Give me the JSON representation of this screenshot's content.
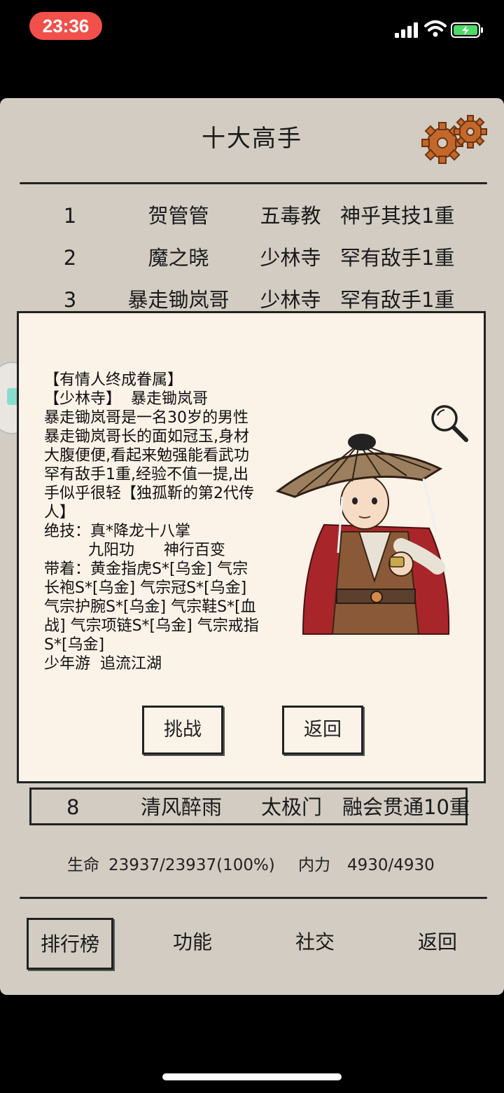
{
  "status_bar": {
    "time": "23:36",
    "time_pill_color": "#f2504a",
    "battery": "charging",
    "icons": [
      "signal-icon",
      "wifi-icon",
      "battery-icon"
    ]
  },
  "header": {
    "title": "十大高手",
    "settings_icon": "gear-icon"
  },
  "ranking": [
    {
      "rank": "1",
      "name": "贺管管",
      "sect": "五毒教",
      "level": "神乎其技1重"
    },
    {
      "rank": "2",
      "name": "魔之晓",
      "sect": "少林寺",
      "level": "罕有敌手1重"
    },
    {
      "rank": "3",
      "name": "暴走锄岚哥",
      "sect": "少林寺",
      "level": "罕有敌手1重"
    }
  ],
  "ranking_row8": {
    "rank": "8",
    "name": "清风醉雨",
    "sect": "太极门",
    "level": "融会贯通10重"
  },
  "detail": {
    "lines": [
      "【有情人终成眷属】",
      "【少林寺】  暴走锄岚哥",
      "暴走锄岚哥是一名30岁的男性",
      "暴走锄岚哥长的面如冠玉,身材大腹便便,看起来勉强能看武功罕有敌手1重,经验不值一提,出手似乎很轻【独孤靳的第2代传人】",
      "绝技：真*降龙十八掌",
      "         九阳功      神行百变",
      "带着：黄金指虎S*[乌金]  气宗长袍S*[乌金]  气宗冠S*[乌金]  气宗护腕S*[乌金]  气宗鞋S*[血战]  气宗项链S*[乌金]  气宗戒指S*[乌金]",
      "少年游  追流江湖"
    ],
    "challenge_label": "挑战",
    "back_label": "返回",
    "zoom_icon": "magnifier-icon"
  },
  "player": {
    "hp_label": "生命",
    "hp_value": "23937/23937(100%)",
    "mp_label": "内力",
    "mp_value": "4930/4930"
  },
  "nav": {
    "items": [
      "排行榜",
      "功能",
      "社交",
      "返回"
    ],
    "active_index": 0
  }
}
